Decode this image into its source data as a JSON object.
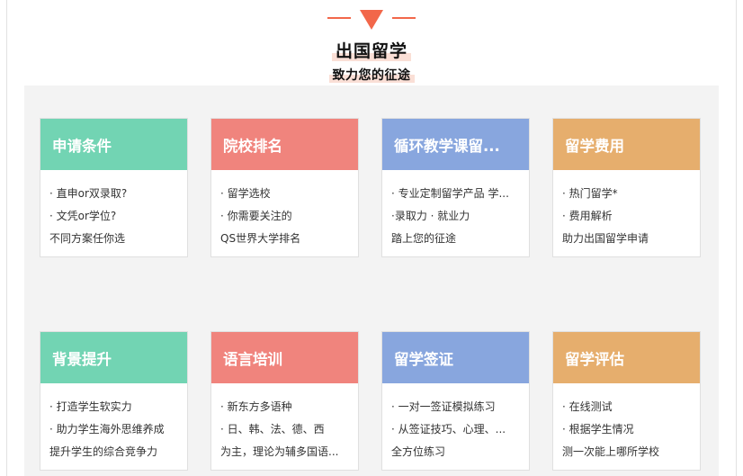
{
  "colors": {
    "accent": "#f2674a",
    "highlight": "#fadfd6",
    "panel_bg": "#f3f3f3",
    "green": "#72d4b3",
    "red": "#f0847d",
    "blue": "#88a6de",
    "orange": "#e6ae6d"
  },
  "header": {
    "title": "出国留学",
    "subtitle": "致力您的征途",
    "deco_icon": "triangle-down-icon"
  },
  "cards": [
    {
      "title": "申请条件",
      "color": "#72d4b3",
      "lines": [
        "· 直申or双录取?",
        "· 文凭or学位?",
        "不同方案任你选"
      ]
    },
    {
      "title": "院校排名",
      "color": "#f0847d",
      "lines": [
        "· 留学选校",
        "· 你需要关注的",
        "QS世界大学排名"
      ]
    },
    {
      "title": "循环教学课留...",
      "color": "#88a6de",
      "lines": [
        "· 专业定制留学产品 学...",
        "·录取力 · 就业力",
        "踏上您的征途"
      ]
    },
    {
      "title": "留学费用",
      "color": "#e6ae6d",
      "lines": [
        "· 热门留学*",
        "· 费用解析",
        "助力出国留学申请"
      ]
    },
    {
      "title": "背景提升",
      "color": "#72d4b3",
      "lines": [
        "· 打造学生软实力",
        "· 助力学生海外思维养成",
        "提升学生的综合竞争力"
      ]
    },
    {
      "title": "语言培训",
      "color": "#f0847d",
      "lines": [
        "· 新东方多语种",
        "· 日、韩、法、德、西",
        "为主，理论为辅多国语..."
      ]
    },
    {
      "title": "留学签证",
      "color": "#88a6de",
      "lines": [
        "· 一对一签证模拟练习",
        "· 从签证技巧、心理、...",
        "全方位练习"
      ]
    },
    {
      "title": "留学评估",
      "color": "#e6ae6d",
      "lines": [
        "· 在线测试",
        "· 根据学生情况",
        "测一次能上哪所学校"
      ]
    }
  ]
}
